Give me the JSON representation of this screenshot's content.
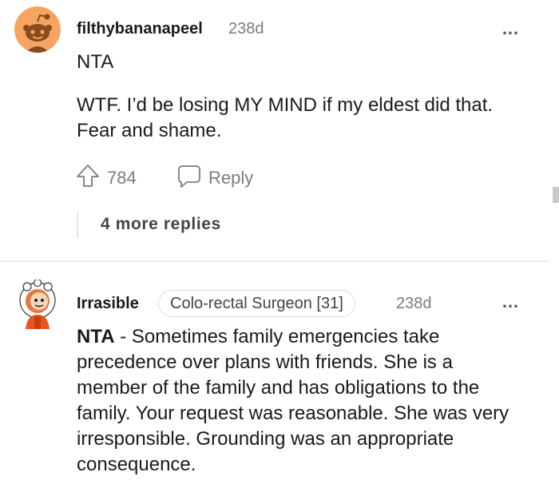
{
  "comments": [
    {
      "username": "filthybananapeel",
      "age": "238d",
      "paragraphs": [
        "NTA",
        "WTF. I’d be losing MY MIND if my eldest did that. Fear and shame."
      ],
      "votes": "784",
      "reply_label": "Reply",
      "more_replies": "4 more replies",
      "avatar_icon": "snoo-avatar-orange"
    },
    {
      "username": "Irrasible",
      "flair": "Colo-rectal Surgeon [31]",
      "age": "238d",
      "body_lead": "NTA",
      "body_rest": " - Sometimes family emergencies take precedence over plans with friends. She is a member of the family and has obligations to the family. Your request was reasonable. She was very irresponsible. Grounding was an appropriate consequence.",
      "avatar_icon": "snoo-avatar-hooded"
    }
  ],
  "more_icon": "…",
  "colors": {
    "text": "#1a1a1b",
    "meta": "#787c7e",
    "avatar_bg": "#f5a461"
  }
}
